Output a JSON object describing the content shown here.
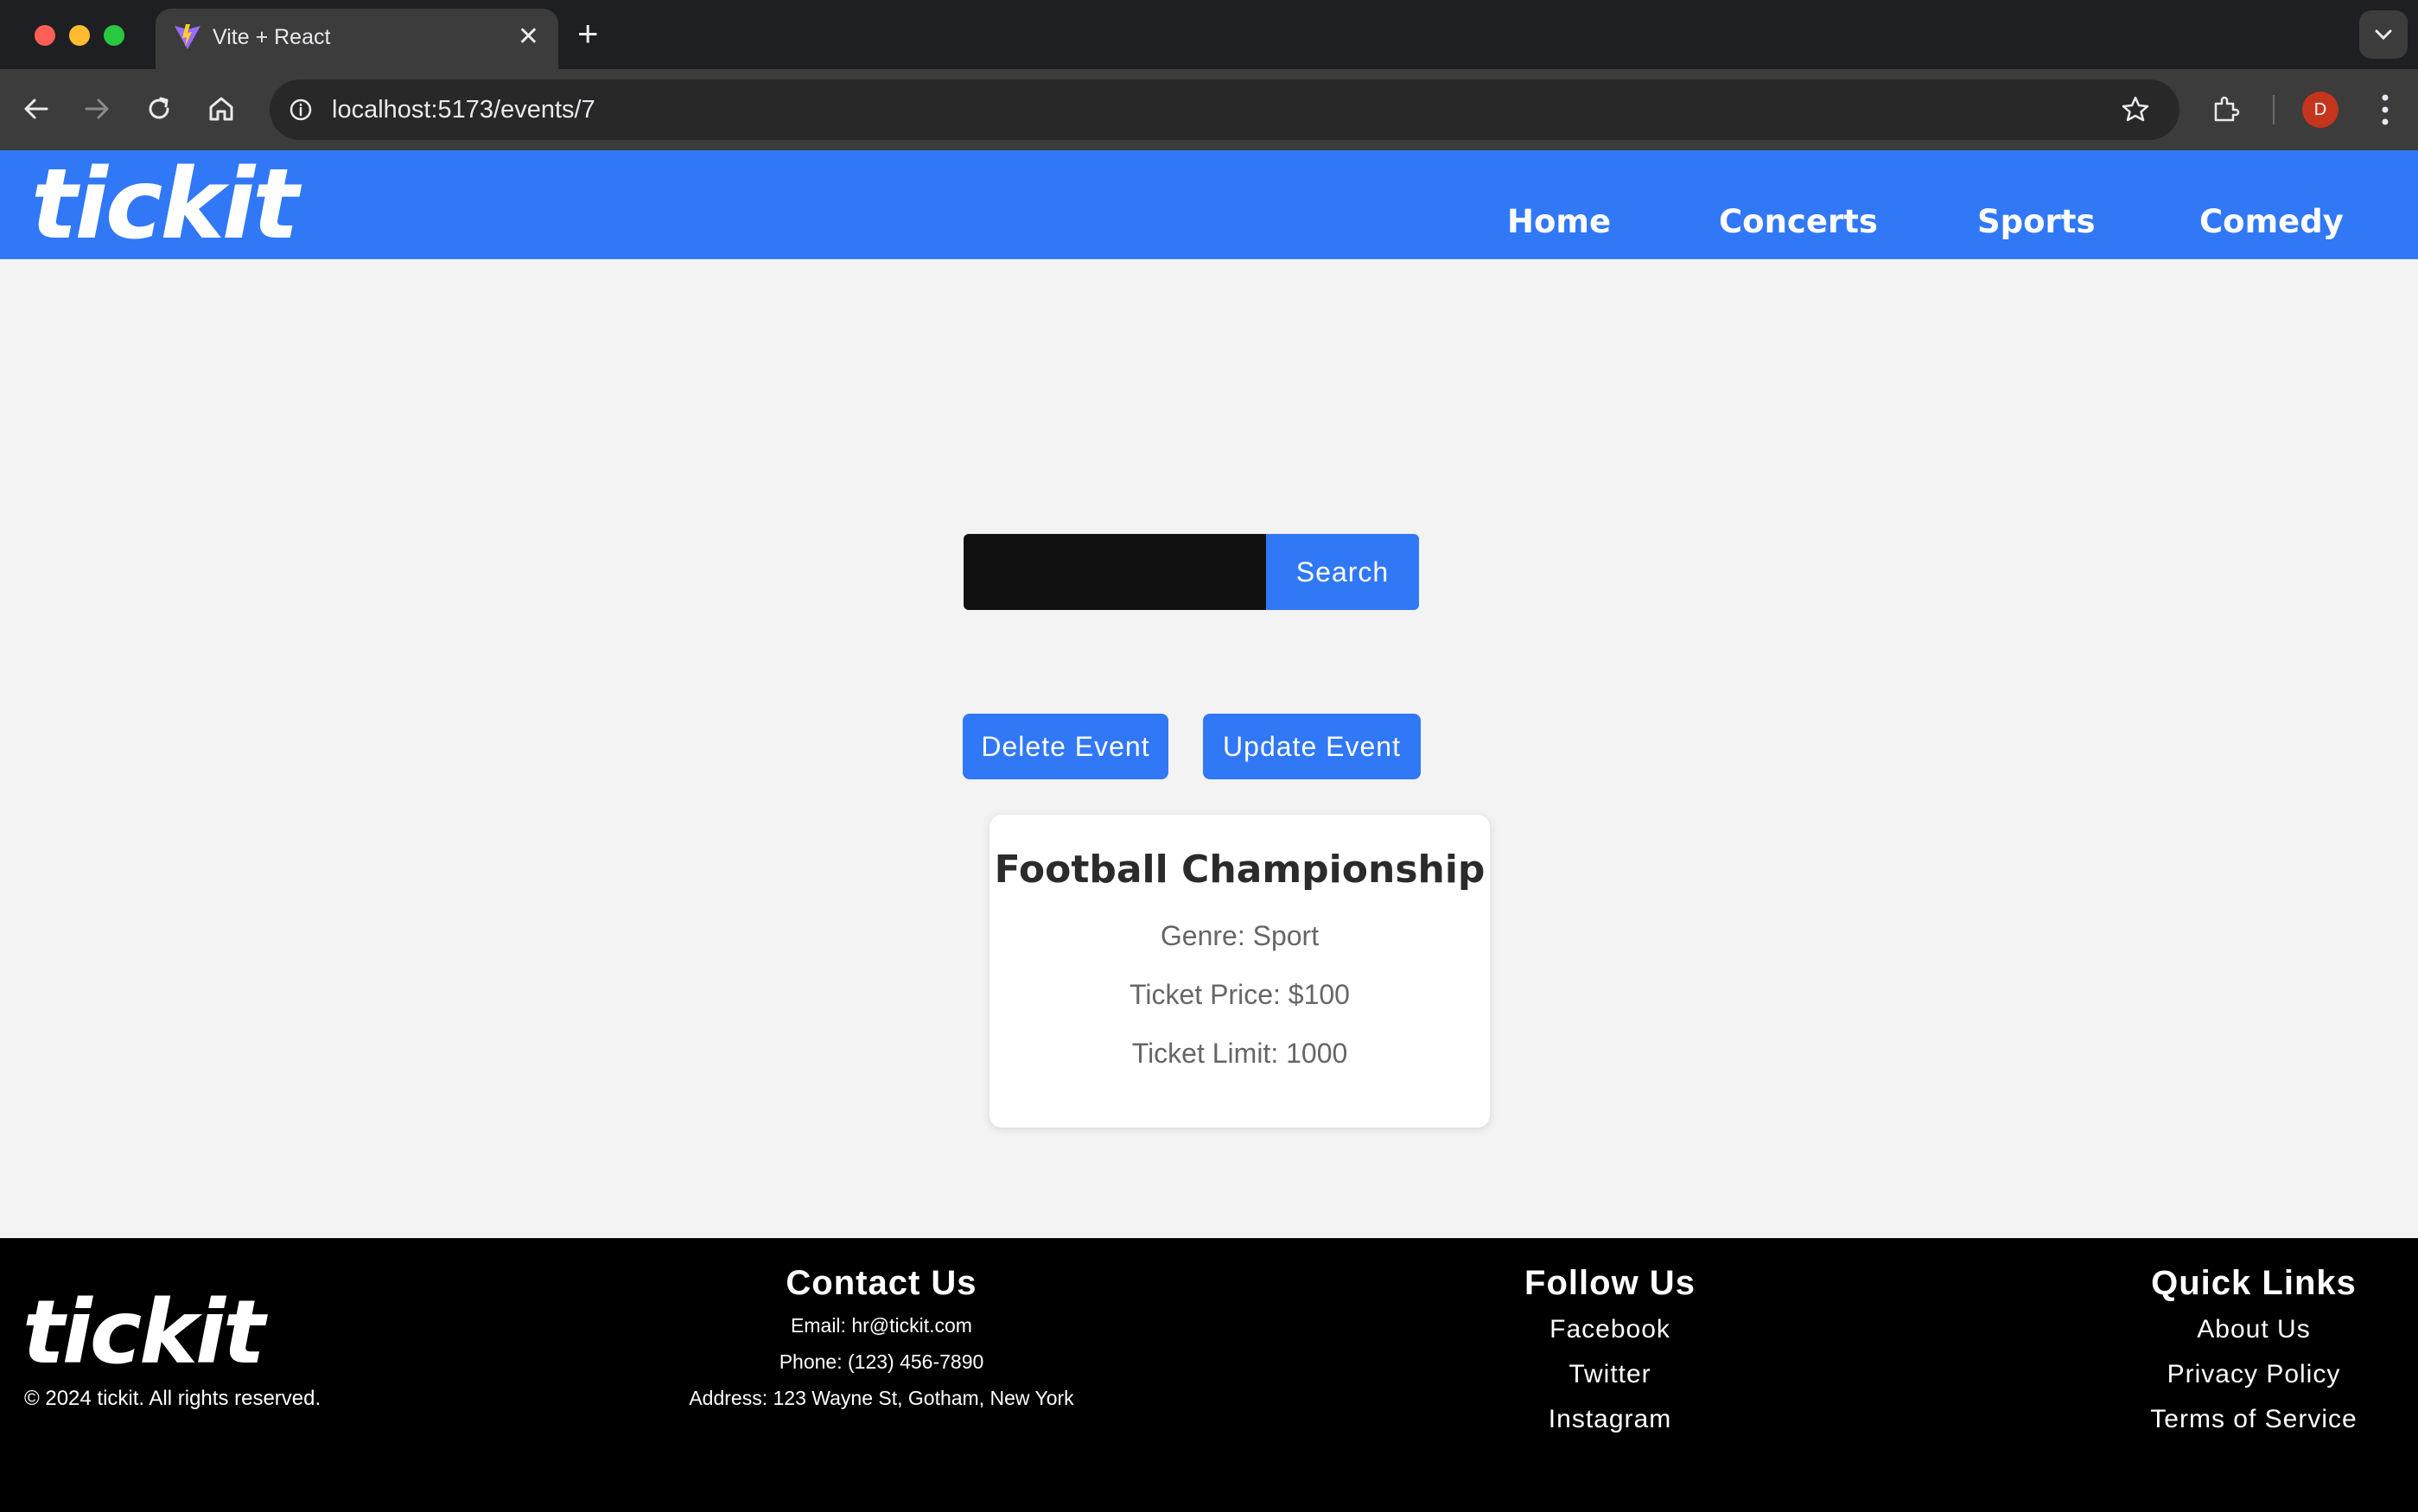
{
  "browser": {
    "tab_title": "Vite + React",
    "url": "localhost:5173/events/7",
    "profile_initial": "D",
    "icons": [
      "back-icon",
      "forward-icon",
      "reload-icon",
      "home-icon",
      "info-icon",
      "star-icon",
      "extensions-icon",
      "menu-icon"
    ]
  },
  "header": {
    "logo": "tickit",
    "nav": [
      "Home",
      "Concerts",
      "Sports",
      "Comedy"
    ]
  },
  "search": {
    "value": "",
    "button_label": "Search"
  },
  "actions": {
    "delete_label": "Delete Event",
    "update_label": "Update Event"
  },
  "event": {
    "title": "Football Championship",
    "genre": "Genre: Sport",
    "price": "Ticket Price: $100",
    "limit": "Ticket Limit: 1000"
  },
  "footer": {
    "logo": "tickit",
    "copyright": "© 2024 tickit. All rights reserved.",
    "contact": {
      "heading": "Contact Us",
      "email": "Email: hr@tickit.com",
      "phone": "Phone: (123) 456-7890",
      "address": "Address: 123 Wayne St, Gotham, New York"
    },
    "follow": {
      "heading": "Follow Us",
      "links": [
        "Facebook",
        "Twitter",
        "Instagram"
      ]
    },
    "quick": {
      "heading": "Quick Links",
      "links": [
        "About Us",
        "Privacy Policy",
        "Terms of Service"
      ]
    }
  },
  "colors": {
    "brand_blue": "#3178f6",
    "page_bg": "#f3f3f3",
    "footer_bg": "#000000",
    "input_bg": "#111111"
  }
}
